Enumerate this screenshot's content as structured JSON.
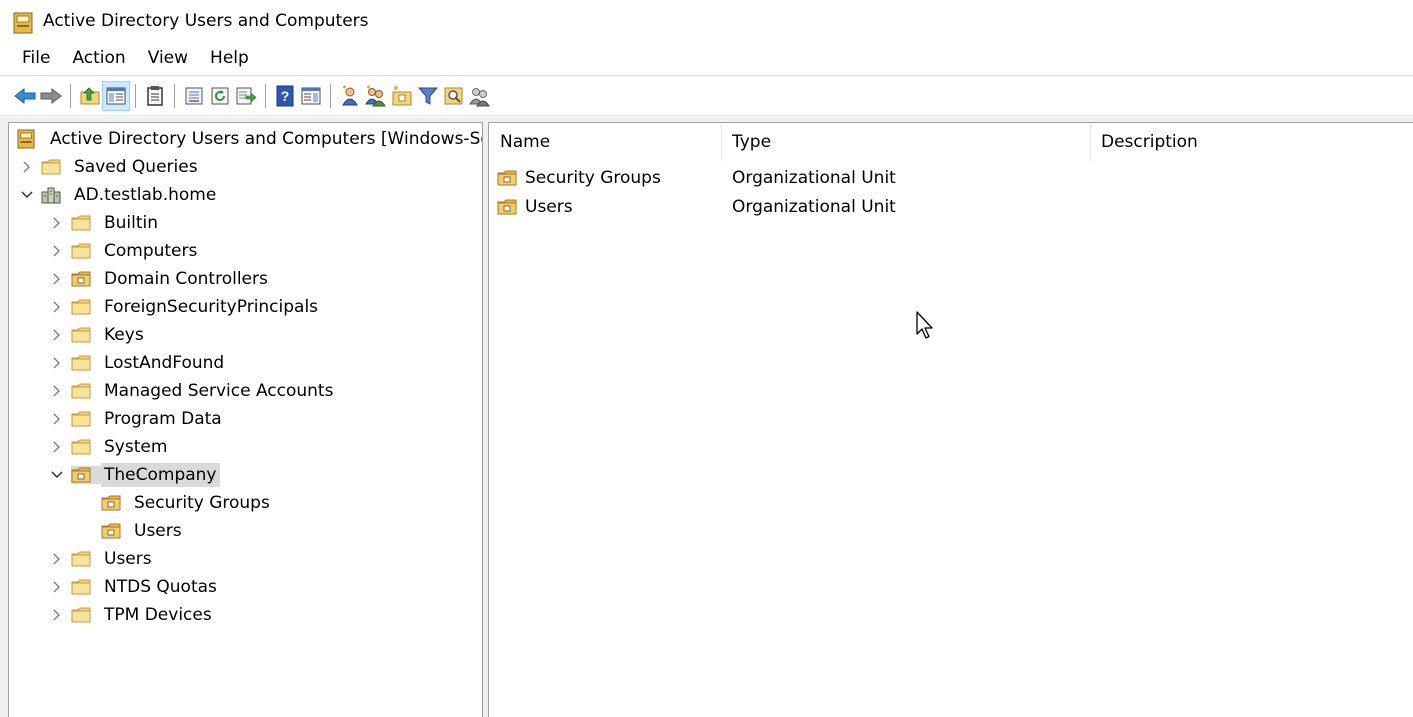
{
  "window": {
    "title": "Active Directory Users and Computers"
  },
  "menu": [
    "File",
    "Action",
    "View",
    "Help"
  ],
  "toolbar": {
    "buttons": [
      {
        "icon": "back-arrow-icon",
        "tooltip": "Back"
      },
      {
        "icon": "forward-arrow-icon",
        "tooltip": "Forward"
      },
      {
        "icon": "up-one-level-icon",
        "tooltip": "Up one level"
      },
      {
        "icon": "show-hide-console-tree-icon",
        "tooltip": "Show/Hide Console Tree",
        "active": true
      },
      {
        "icon": "clipboard-icon",
        "tooltip": "Copy"
      },
      {
        "icon": "properties-icon",
        "tooltip": "Properties"
      },
      {
        "icon": "refresh-icon",
        "tooltip": "Refresh"
      },
      {
        "icon": "export-list-icon",
        "tooltip": "Export List"
      },
      {
        "icon": "help-icon",
        "tooltip": "Help"
      },
      {
        "icon": "show-action-pane-icon",
        "tooltip": "Show/Hide Action Pane"
      },
      {
        "icon": "create-user-icon",
        "tooltip": "Create a new user"
      },
      {
        "icon": "create-group-icon",
        "tooltip": "Create a new group"
      },
      {
        "icon": "create-ou-icon",
        "tooltip": "Create a new organizational unit"
      },
      {
        "icon": "filter-icon",
        "tooltip": "Add criteria to filter"
      },
      {
        "icon": "find-icon",
        "tooltip": "Find objects"
      },
      {
        "icon": "add-to-group-icon",
        "tooltip": "Add the selected object to a group"
      }
    ]
  },
  "tree": {
    "root_label": "Active Directory Users and Computers [Windows-Ser",
    "items": [
      {
        "label": "Saved Queries",
        "expanded": false,
        "icon": "folder"
      },
      {
        "label": "AD.testlab.home",
        "expanded": true,
        "icon": "domain"
      },
      {
        "label": "Builtin",
        "expanded": false,
        "icon": "folder"
      },
      {
        "label": "Computers",
        "expanded": false,
        "icon": "folder"
      },
      {
        "label": "Domain Controllers",
        "expanded": false,
        "icon": "ou"
      },
      {
        "label": "ForeignSecurityPrincipals",
        "expanded": false,
        "icon": "folder"
      },
      {
        "label": "Keys",
        "expanded": false,
        "icon": "folder"
      },
      {
        "label": "LostAndFound",
        "expanded": false,
        "icon": "folder"
      },
      {
        "label": "Managed Service Accounts",
        "expanded": false,
        "icon": "folder"
      },
      {
        "label": "Program Data",
        "expanded": false,
        "icon": "folder"
      },
      {
        "label": "System",
        "expanded": false,
        "icon": "folder"
      },
      {
        "label": "TheCompany",
        "expanded": true,
        "icon": "ou",
        "selected": true
      },
      {
        "label": "Security Groups",
        "icon": "ou"
      },
      {
        "label": "Users",
        "icon": "ou"
      },
      {
        "label": "Users",
        "expanded": false,
        "icon": "folder"
      },
      {
        "label": "NTDS Quotas",
        "expanded": false,
        "icon": "folder"
      },
      {
        "label": "TPM Devices",
        "expanded": false,
        "icon": "folder"
      }
    ]
  },
  "list": {
    "columns": [
      "Name",
      "Type",
      "Description"
    ],
    "rows": [
      {
        "name": "Security Groups",
        "type": "Organizational Unit",
        "description": ""
      },
      {
        "name": "Users",
        "type": "Organizational Unit",
        "description": ""
      }
    ]
  },
  "colors": {
    "folder": "#f3d57b",
    "folder_dark": "#d9a83a",
    "selection": "#d9d9d9",
    "active_button": "#cde8ff"
  }
}
